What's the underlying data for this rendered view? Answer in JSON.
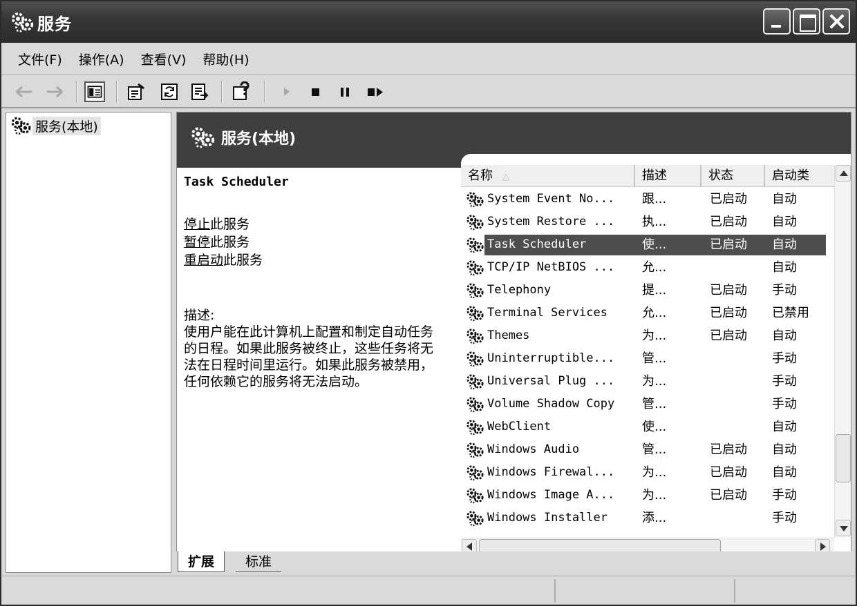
{
  "window": {
    "title": "服务"
  },
  "menu": [
    {
      "label": "文件(F)"
    },
    {
      "label": "操作(A)"
    },
    {
      "label": "查看(V)"
    },
    {
      "label": "帮助(H)"
    }
  ],
  "toolbar": {
    "icons": [
      "back-arrow-icon",
      "forward-arrow-icon",
      "show-hide-console-tree-icon",
      "properties-icon",
      "refresh-icon",
      "export-list-icon",
      "help-icon",
      "start-service-icon",
      "stop-service-icon",
      "pause-service-icon",
      "restart-service-icon"
    ]
  },
  "tree": {
    "root": "服务(本地)"
  },
  "panel": {
    "header": "服务(本地)"
  },
  "extended": {
    "service_name": "Task Scheduler",
    "stop_link": "停止",
    "stop_suffix": "此服务",
    "pause_link": "暂停",
    "pause_suffix": "此服务",
    "restart_link": "重启动",
    "restart_suffix": "此服务",
    "desc_label": "描述:",
    "desc_text": "使用户能在此计算机上配置和制定自动任务的日程。如果此服务被终止，这些任务将无法在日程时间里运行。如果此服务被禁用，任何依赖它的服务将无法启动。"
  },
  "list": {
    "columns": [
      "名称",
      "描述",
      "状态",
      "启动类"
    ],
    "selected_index": 2,
    "rows": [
      {
        "name": "System Event No...",
        "desc": "跟...",
        "status": "已启动",
        "startup": "自动"
      },
      {
        "name": "System Restore ...",
        "desc": "执...",
        "status": "已启动",
        "startup": "自动"
      },
      {
        "name": "Task Scheduler",
        "desc": "使...",
        "status": "已启动",
        "startup": "自动"
      },
      {
        "name": "TCP/IP NetBIOS ...",
        "desc": "允...",
        "status": "",
        "startup": "自动"
      },
      {
        "name": "Telephony",
        "desc": "提...",
        "status": "已启动",
        "startup": "手动"
      },
      {
        "name": "Terminal Services",
        "desc": "允...",
        "status": "已启动",
        "startup": "已禁用"
      },
      {
        "name": "Themes",
        "desc": "为...",
        "status": "已启动",
        "startup": "自动"
      },
      {
        "name": "Uninterruptible...",
        "desc": "管...",
        "status": "",
        "startup": "手动"
      },
      {
        "name": "Universal Plug ...",
        "desc": "为...",
        "status": "",
        "startup": "手动"
      },
      {
        "name": "Volume Shadow Copy",
        "desc": "管...",
        "status": "",
        "startup": "手动"
      },
      {
        "name": "WebClient",
        "desc": "使...",
        "status": "",
        "startup": "自动"
      },
      {
        "name": "Windows Audio",
        "desc": "管...",
        "status": "已启动",
        "startup": "自动"
      },
      {
        "name": "Windows Firewal...",
        "desc": "为...",
        "status": "已启动",
        "startup": "自动"
      },
      {
        "name": "Windows Image A...",
        "desc": "为...",
        "status": "已启动",
        "startup": "手动"
      },
      {
        "name": "Windows Installer",
        "desc": "添...",
        "status": "",
        "startup": "手动"
      }
    ]
  },
  "tabs": [
    {
      "label": "扩展"
    },
    {
      "label": "标准"
    }
  ]
}
